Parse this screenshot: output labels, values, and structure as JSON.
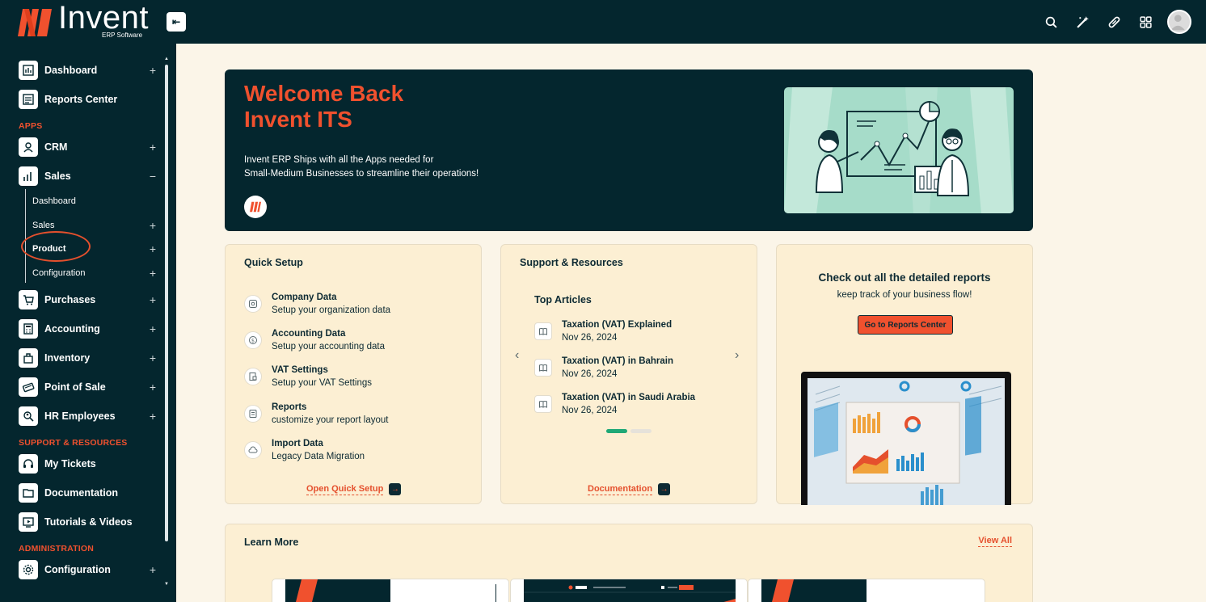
{
  "brand": {
    "name": "Invent",
    "tagline": "ERP Software",
    "primary_color": "#04262e",
    "accent_color": "#f0512e"
  },
  "sidebar": {
    "collapse_icon": "collapse-left-icon",
    "items_top": [
      {
        "label": "Dashboard",
        "icon": "dashboard-icon",
        "expand": "+"
      },
      {
        "label": "Reports Center",
        "icon": "reports-icon",
        "expand": ""
      }
    ],
    "apps_label": "APPS",
    "apps": [
      {
        "label": "CRM",
        "icon": "crm-icon",
        "expand": "+"
      },
      {
        "label": "Sales",
        "icon": "sales-icon",
        "expand": "−"
      }
    ],
    "sales_sub": [
      {
        "label": "Dashboard",
        "expand": ""
      },
      {
        "label": "Sales",
        "expand": "+"
      },
      {
        "label": "Product",
        "expand": "+"
      },
      {
        "label": "Configuration",
        "expand": "+"
      }
    ],
    "apps_rest": [
      {
        "label": "Purchases",
        "icon": "purchases-icon",
        "expand": "+"
      },
      {
        "label": "Accounting",
        "icon": "accounting-icon",
        "expand": "+"
      },
      {
        "label": "Inventory",
        "icon": "inventory-icon",
        "expand": "+"
      },
      {
        "label": "Point of Sale",
        "icon": "pos-icon",
        "expand": "+"
      },
      {
        "label": "HR Employees",
        "icon": "hr-icon",
        "expand": "+"
      }
    ],
    "support_label": "SUPPORT & RESOURCES",
    "support": [
      {
        "label": "My Tickets",
        "icon": "headset-icon"
      },
      {
        "label": "Documentation",
        "icon": "document-icon"
      },
      {
        "label": "Tutorials & Videos",
        "icon": "video-icon"
      }
    ],
    "admin_label": "ADMINISTRATION",
    "admin": [
      {
        "label": "Configuration",
        "icon": "gear-icon",
        "expand": "+"
      }
    ]
  },
  "topbar": {
    "icons": [
      "search-icon",
      "magic-wand-icon",
      "pill-icon",
      "apps-grid-icon",
      "avatar"
    ]
  },
  "banner": {
    "title_line1": "Welcome Back",
    "title_line2": "Invent ITS",
    "desc_line1": "Invent ERP Ships with all the Apps needed for",
    "desc_line2": "Small-Medium Businesses to streamline their operations!"
  },
  "quick_setup": {
    "title": "Quick Setup",
    "items": [
      {
        "title": "Company Data",
        "sub": "Setup your organization data",
        "icon": "company-icon"
      },
      {
        "title": "Accounting Data",
        "sub": "Setup your accounting data",
        "icon": "dollar-icon"
      },
      {
        "title": "VAT Settings",
        "sub": "Setup your VAT Settings",
        "icon": "vat-icon"
      },
      {
        "title": "Reports",
        "sub": "customize your report layout",
        "icon": "report-icon"
      },
      {
        "title": "Import Data",
        "sub": "Legacy Data Migration",
        "icon": "cloud-icon"
      }
    ],
    "link": "Open Quick Setup"
  },
  "support_resources": {
    "title": "Support & Resources",
    "subtitle": "Top Articles",
    "articles": [
      {
        "title": "Taxation (VAT) Explained",
        "date": "Nov 26, 2024"
      },
      {
        "title": "Taxation (VAT) in Bahrain",
        "date": "Nov 26, 2024"
      },
      {
        "title": "Taxation (VAT) in Saudi Arabia",
        "date": "Nov 26, 2024"
      }
    ],
    "link": "Documentation",
    "dot_active_color": "#1fa876",
    "dot_inactive_color": "#e6e2da"
  },
  "reports_card": {
    "title": "Check out all the detailed reports",
    "sub": "keep track of your business flow!",
    "button": "Go to Reports Center"
  },
  "learn_more": {
    "title": "Learn More",
    "view_all": "View All"
  }
}
